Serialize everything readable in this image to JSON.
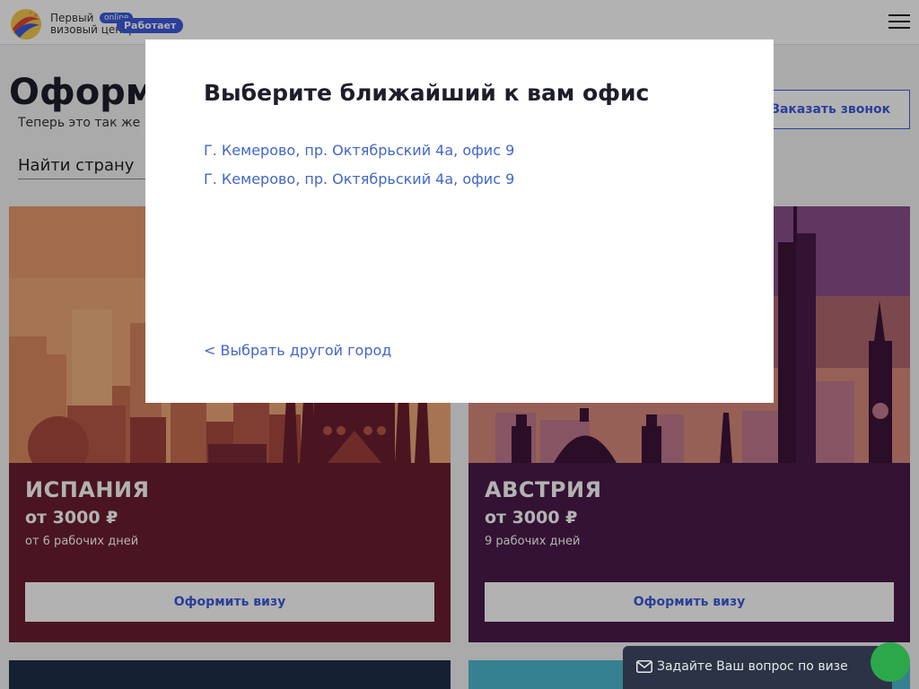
{
  "header": {
    "logo_line1": "Первый",
    "logo_line2": "визовый центр",
    "online_badge": "online",
    "status_badge": "Работает"
  },
  "page": {
    "title": "Оформление визы",
    "subtitle": "Теперь это так же просто",
    "callback_label": "Заказать звонок",
    "search_placeholder": "Найти страну"
  },
  "cards": [
    {
      "name": "ИСПАНИЯ",
      "price": "от 3000 ₽",
      "days": "от 6 рабочих дней",
      "button": "Оформить визу"
    },
    {
      "name": "АВСТРИЯ",
      "price": "от 3000 ₽",
      "days": "9 рабочих дней",
      "button": "Оформить визу"
    }
  ],
  "modal": {
    "title": "Выберите ближайший к вам офис",
    "offices": [
      "Г. Кемерово, пр. Октябрьский 4а, офис 9",
      "Г. Кемерово, пр. Октябрьский 4а, офис 9"
    ],
    "back_link": "< Выбрать другой город"
  },
  "chat": {
    "label": "Задайте Ваш вопрос по визе",
    "icon": "envelope-icon"
  },
  "colors": {
    "accent": "#3b5bdb",
    "link": "#4266c9",
    "spain_card": "#6b1f2f",
    "austria_card": "#4a1b4a",
    "chat_bg": "#2c3346"
  }
}
